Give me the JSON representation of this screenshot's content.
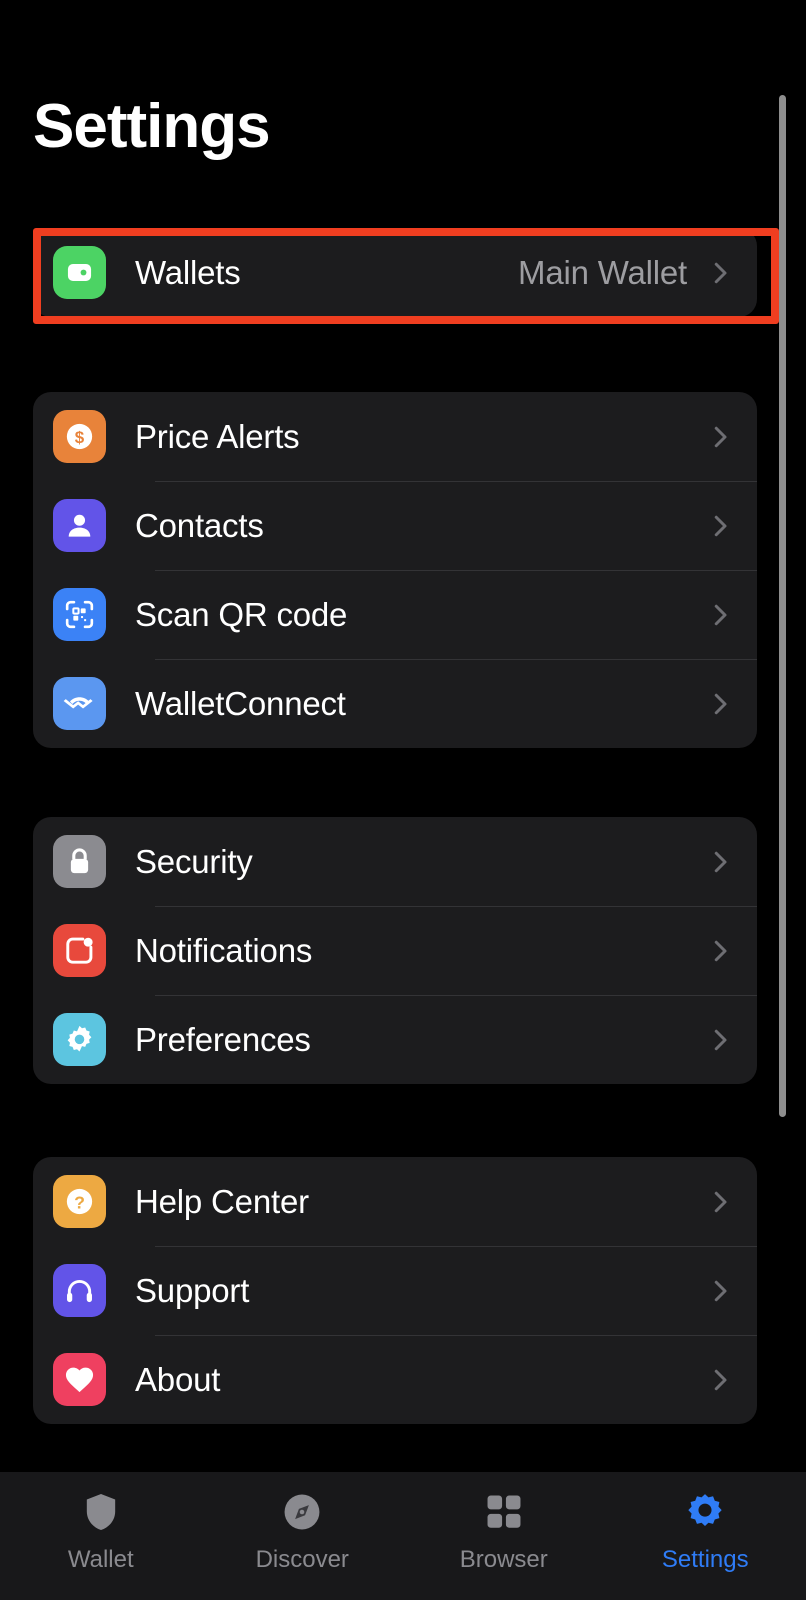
{
  "header": {
    "title": "Settings"
  },
  "colors": {
    "background": "#000000",
    "card": "#1c1c1e",
    "separator": "#333336",
    "label": "#ffffff",
    "value": "#9d9da1",
    "chevron": "#6e6e73",
    "highlight": "#f03e20",
    "accent": "#2f7cf6",
    "tabbar_background": "#18181a",
    "tab_inactive": "#8a8a8f",
    "scrollbar": "#8e8e8e"
  },
  "groups": [
    {
      "name": "wallets-group",
      "highlighted": true,
      "rows": [
        {
          "id": "wallets",
          "label": "Wallets",
          "value": "Main Wallet",
          "icon": "wallet-icon",
          "icon_bg": "#4cd364",
          "chevron": true
        }
      ]
    },
    {
      "name": "tools-group",
      "highlighted": false,
      "rows": [
        {
          "id": "price-alerts",
          "label": "Price Alerts",
          "value": "",
          "icon": "dollar-circle-icon",
          "icon_bg": "#e8833a",
          "chevron": true
        },
        {
          "id": "contacts",
          "label": "Contacts",
          "value": "",
          "icon": "person-icon",
          "icon_bg": "#6254e8",
          "chevron": true
        },
        {
          "id": "scan-qr-code",
          "label": "Scan QR code",
          "value": "",
          "icon": "qr-scan-icon",
          "icon_bg": "#3b82f6",
          "chevron": true
        },
        {
          "id": "walletconnect",
          "label": "WalletConnect",
          "value": "",
          "icon": "walletconnect-icon",
          "icon_bg": "#5b97f0",
          "chevron": true
        }
      ]
    },
    {
      "name": "system-group",
      "highlighted": false,
      "rows": [
        {
          "id": "security",
          "label": "Security",
          "value": "",
          "icon": "lock-icon",
          "icon_bg": "#8b8b90",
          "chevron": true
        },
        {
          "id": "notifications",
          "label": "Notifications",
          "value": "",
          "icon": "notification-icon",
          "icon_bg": "#e8493c",
          "chevron": true
        },
        {
          "id": "preferences",
          "label": "Preferences",
          "value": "",
          "icon": "gear-icon",
          "icon_bg": "#5cc5e0",
          "chevron": true
        }
      ]
    },
    {
      "name": "help-group",
      "highlighted": false,
      "rows": [
        {
          "id": "help-center",
          "label": "Help Center",
          "value": "",
          "icon": "question-circle-icon",
          "icon_bg": "#eda942",
          "chevron": true
        },
        {
          "id": "support",
          "label": "Support",
          "value": "",
          "icon": "headphones-icon",
          "icon_bg": "#6254e8",
          "chevron": true
        },
        {
          "id": "about",
          "label": "About",
          "value": "",
          "icon": "heart-icon",
          "icon_bg": "#ef4060",
          "chevron": true
        }
      ]
    }
  ],
  "tabbar": {
    "tabs": [
      {
        "id": "wallet",
        "label": "Wallet",
        "icon": "shield-icon",
        "active": false
      },
      {
        "id": "discover",
        "label": "Discover",
        "icon": "compass-icon",
        "active": false
      },
      {
        "id": "browser",
        "label": "Browser",
        "icon": "grid-icon",
        "active": false
      },
      {
        "id": "settings",
        "label": "Settings",
        "icon": "gear-icon",
        "active": true
      }
    ]
  }
}
